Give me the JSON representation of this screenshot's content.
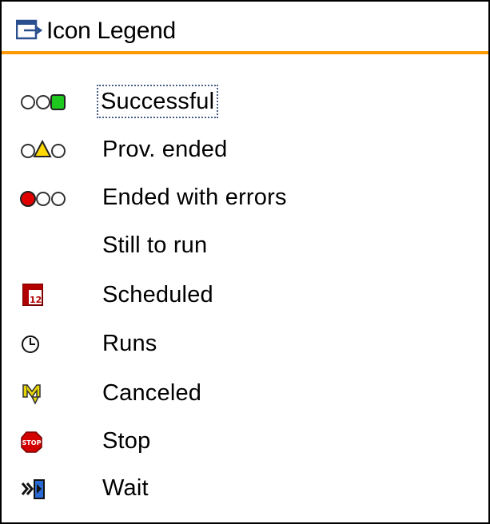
{
  "header": {
    "title": "Icon Legend",
    "icon": "legend-icon"
  },
  "accent": "#ff9900",
  "legend": [
    {
      "label": "Successful",
      "icon": "traffic-light-green-icon"
    },
    {
      "label": "Prov. ended",
      "icon": "traffic-light-yellow-icon"
    },
    {
      "label": "Ended with errors",
      "icon": "traffic-light-red-icon"
    },
    {
      "label": "Still to run",
      "icon": ""
    },
    {
      "label": "Scheduled",
      "icon": "calendar-icon"
    },
    {
      "label": "Runs",
      "icon": "clock-icon"
    },
    {
      "label": "Canceled",
      "icon": "canceled-icon"
    },
    {
      "label": "Stop",
      "icon": "stop-sign-icon"
    },
    {
      "label": "Wait",
      "icon": "wait-icon"
    }
  ],
  "colors": {
    "green": "#1ec81e",
    "yellow": "#ffd800",
    "red": "#e00000",
    "stop": "#d40000",
    "wait": "#2a6ad4"
  }
}
